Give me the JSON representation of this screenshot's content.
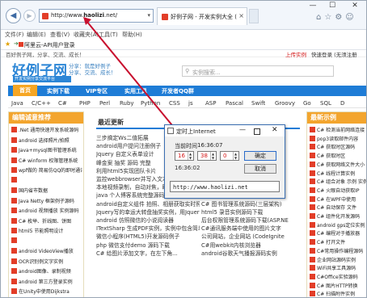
{
  "browser": {
    "url_prefix": "http://www.",
    "url_bold": "haolizi",
    "url_suffix": ".net/",
    "tab_title": "好例子网 - 开发实例大全 (",
    "tab_close": "×",
    "menu": [
      "文件(F)",
      "编辑(E)",
      "查看(V)",
      "收藏夹(A)",
      "工具(T)",
      "帮助(H)"
    ],
    "favorite_link": "阿里云-API用户登录",
    "window_buttons": {
      "minimize": "—",
      "maximize": "☐",
      "close": "✕"
    }
  },
  "site": {
    "topbar_left": "百好例子网，分享、交流、成长！",
    "topbar_upload": "上传实例",
    "topbar_login": "快速登录 (无须注册",
    "logo": "好例子网",
    "logo_sub": "开发实例分享交流平台",
    "slogan_line1": "分享：就是好例子",
    "slogan_line2": "分享、交流、成长！",
    "search_placeholder": "实例搜索...",
    "nav": [
      "首页",
      "实例下载",
      "VIP专区",
      "实用工具",
      "开发者QQ群"
    ],
    "subnav": [
      "Java",
      "C/C++",
      "C#",
      "PHP",
      "Perl",
      "Ruby",
      "Python",
      "CSS",
      "js",
      "ASP",
      "Pascal",
      "Swift",
      "Groovy",
      "Go",
      "SQL",
      "D"
    ],
    "left_title": "编辑诚意推荐",
    "left_items": [
      ".Net 通用快速开发系统源码",
      "android 选择照片/拍照",
      "Java+mysql图书管理系统",
      "C# winform 权限管理系统",
      "wpf做的 简易仿QQ的即时通讯",
      "",
      "国内省市数据",
      "Java Netty 框架例子源码",
      "android 视频播放 实例源码",
      "C# 枚举、折线图、饼图",
      "html5 节能照明设计",
      "",
      "android VideoView播放",
      "OCR识别例文字实例",
      "android图像、录制视频",
      "android 第三方登录实例",
      "在Unity中使用Dijkstra"
    ],
    "center_title": "最近更新",
    "center_items": [
      "三步搞定Ws二值拓展",
      "android用户提问注册例子",
      "Jquery 自定义表单设计",
      "峰金案 抽奖 源码 完整",
      "利用html5实现团队卡片",
      "监控webbrowser并写入文本",
      "本地视频录制，自动对焦，时间显示，录像完成！",
      "java 个人博客系统完整源码",
      "android自定义组件 拍照、相册获取实时照片图片并上传",
      "Jquery写的幸运大转盘抽奖实例，用Jquery实现，上传",
      "android 仿照微信的小说阅读器",
      "ITextSharp 生成PDF实例，实例中包含简单的PDF排版",
      "微信小程序(HTML5)开发源码例子",
      "php 微信支付demo 源码下载",
      "C# 给图片添加文字，在左下角..."
    ],
    "center_right_items": [
      "",
      "",
      "",
      "",
      "",
      "",
      "",
      "jQuery Validation 表单验证实例",
      "C# 图书管理系统源码(三层架构)",
      "html5 录音实例源码下载",
      "后台权限管理系统源码下载(ASP.NE",
      "C#通讯服务端中使用的图片文字",
      "公司网站，企业网站 (CodeIgnite",
      "C#用webkit内核浏览器",
      "android谷歌天气播报源码实例"
    ],
    "right_title": "最新示例",
    "right_items": [
      "C# 检测当前网络连接",
      "pop3读取邮件内容",
      "C# 获取时区源码",
      "C# 获取时区",
      "C# 获取网络文件大小",
      "C# 线程计算实例",
      "C# 组合对象 示例 实例",
      "C# 火眼自动获取IP",
      "C# 在WPF中使用",
      "C# 自动保存 文件",
      "C# 组件化开发源码",
      "android gps定位实例",
      "C# 编程对于播放器",
      "C# 打开文件",
      "C#常用操作编程源码",
      "企业网站源码实例",
      "WiFi共享工具源码",
      "C#Office实验源码",
      "C# 图片HTTP转换",
      "C# 扫描附件实例"
    ]
  },
  "dialog": {
    "title": "定时上Internet",
    "current_time_label": "当前时间",
    "current_time_value": "16:36:07",
    "hour": "16",
    "minute": "38",
    "second": "0",
    "set_time_label": "16:36:02",
    "ok_label": "确定",
    "cancel_label": "取消",
    "url_value": "http://www.haolizi.net"
  },
  "colors": {
    "accent_blue": "#1e7cd6",
    "orange": "#f3a52e",
    "arrow_red": "#c8102e"
  }
}
